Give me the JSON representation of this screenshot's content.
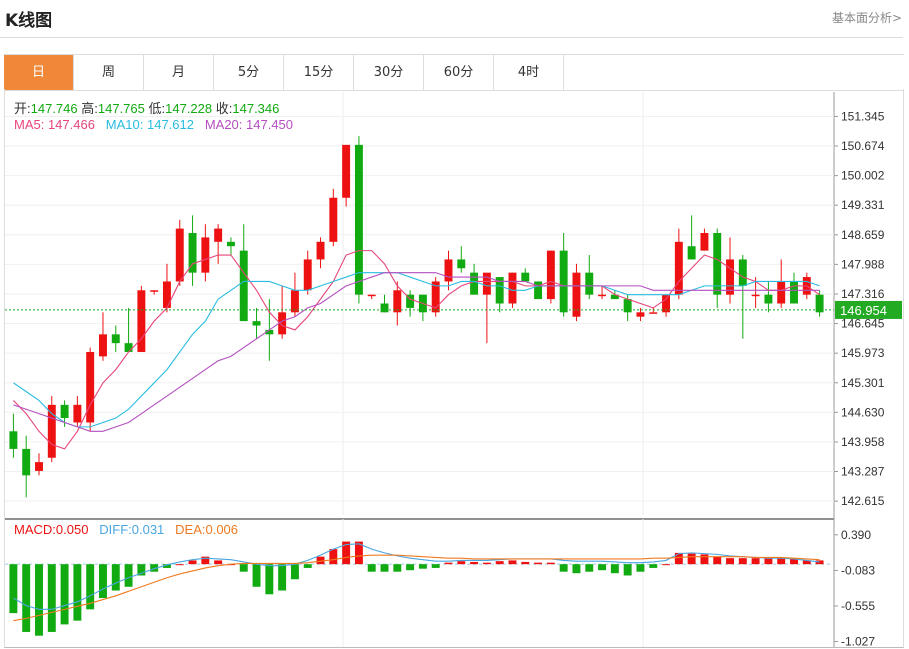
{
  "header": {
    "title": "K线图",
    "analysis_link": "基本面分析>"
  },
  "tabs": [
    {
      "label": "日",
      "active": true
    },
    {
      "label": "周",
      "active": false
    },
    {
      "label": "月",
      "active": false
    },
    {
      "label": "5分",
      "active": false
    },
    {
      "label": "15分",
      "active": false
    },
    {
      "label": "30分",
      "active": false
    },
    {
      "label": "60分",
      "active": false
    },
    {
      "label": "4时",
      "active": false
    }
  ],
  "ohlc_info": {
    "open_label": "开:",
    "open": "147.746",
    "high_label": "高:",
    "high": "147.765",
    "low_label": "低:",
    "low": "147.228",
    "close_label": "收:",
    "close": "147.346"
  },
  "ma_info": {
    "ma5": "MA5: 147.466",
    "ma10": "MA10: 147.612",
    "ma20": "MA20: 147.450"
  },
  "macd_info": {
    "macd": "MACD:0.050",
    "diff": "DIFF:0.031",
    "dea": "DEA:0.006"
  },
  "colors": {
    "up": "#ee1111",
    "down": "#11aa11",
    "ma5": "#e8457a",
    "ma10": "#29bce0",
    "ma20": "#b44fc0",
    "diff": "#4aa6e0",
    "dea": "#f07a20",
    "current": "#22aa22"
  },
  "chart_data": [
    {
      "type": "candlestick",
      "title": "",
      "price_axis_ticks": [
        "151.345",
        "150.674",
        "150.002",
        "149.331",
        "148.659",
        "147.988",
        "147.316",
        "146.645",
        "145.973",
        "145.301",
        "144.630",
        "143.958",
        "143.287",
        "142.615"
      ],
      "ylim": [
        142.3,
        151.9
      ],
      "current_price": "146.954",
      "candles": [
        {
          "o": 144.2,
          "h": 144.6,
          "l": 143.6,
          "c": 143.8
        },
        {
          "o": 143.8,
          "h": 144.1,
          "l": 142.7,
          "c": 143.2
        },
        {
          "o": 143.3,
          "h": 143.7,
          "l": 143.2,
          "c": 143.5
        },
        {
          "o": 143.6,
          "h": 145.0,
          "l": 143.5,
          "c": 144.8
        },
        {
          "o": 144.8,
          "h": 144.9,
          "l": 144.3,
          "c": 144.5
        },
        {
          "o": 144.4,
          "h": 145.0,
          "l": 144.3,
          "c": 144.8
        },
        {
          "o": 144.4,
          "h": 146.1,
          "l": 144.2,
          "c": 146.0
        },
        {
          "o": 145.9,
          "h": 146.9,
          "l": 145.8,
          "c": 146.4
        },
        {
          "o": 146.4,
          "h": 146.6,
          "l": 146.0,
          "c": 146.2
        },
        {
          "o": 146.2,
          "h": 147.0,
          "l": 146.0,
          "c": 146.0
        },
        {
          "o": 146.0,
          "h": 147.5,
          "l": 146.0,
          "c": 147.4
        },
        {
          "o": 147.4,
          "h": 147.4,
          "l": 147.3,
          "c": 147.4
        },
        {
          "o": 147.0,
          "h": 148.0,
          "l": 146.9,
          "c": 147.6
        },
        {
          "o": 147.6,
          "h": 149.0,
          "l": 147.5,
          "c": 148.8
        },
        {
          "o": 148.7,
          "h": 149.1,
          "l": 147.5,
          "c": 147.8
        },
        {
          "o": 147.8,
          "h": 148.9,
          "l": 147.6,
          "c": 148.6
        },
        {
          "o": 148.5,
          "h": 148.9,
          "l": 148.0,
          "c": 148.8
        },
        {
          "o": 148.5,
          "h": 148.6,
          "l": 148.2,
          "c": 148.4
        },
        {
          "o": 148.3,
          "h": 148.9,
          "l": 146.8,
          "c": 146.7
        },
        {
          "o": 146.7,
          "h": 147.0,
          "l": 146.3,
          "c": 146.6
        },
        {
          "o": 146.5,
          "h": 147.2,
          "l": 145.8,
          "c": 146.4
        },
        {
          "o": 146.4,
          "h": 147.5,
          "l": 146.3,
          "c": 146.9
        },
        {
          "o": 146.9,
          "h": 147.8,
          "l": 146.8,
          "c": 147.4
        },
        {
          "o": 147.4,
          "h": 148.3,
          "l": 147.3,
          "c": 148.1
        },
        {
          "o": 148.1,
          "h": 148.6,
          "l": 147.9,
          "c": 148.5
        },
        {
          "o": 148.5,
          "h": 149.7,
          "l": 148.4,
          "c": 149.5
        },
        {
          "o": 149.5,
          "h": 150.7,
          "l": 149.3,
          "c": 150.7
        },
        {
          "o": 150.7,
          "h": 150.9,
          "l": 147.1,
          "c": 147.3
        },
        {
          "o": 147.3,
          "h": 147.3,
          "l": 147.2,
          "c": 147.3
        },
        {
          "o": 147.1,
          "h": 147.3,
          "l": 146.9,
          "c": 146.9
        },
        {
          "o": 146.9,
          "h": 147.6,
          "l": 146.6,
          "c": 147.4
        },
        {
          "o": 147.3,
          "h": 147.4,
          "l": 146.8,
          "c": 147.0
        },
        {
          "o": 147.3,
          "h": 147.3,
          "l": 146.7,
          "c": 146.9
        },
        {
          "o": 146.9,
          "h": 147.7,
          "l": 146.8,
          "c": 147.6
        },
        {
          "o": 147.6,
          "h": 148.3,
          "l": 147.4,
          "c": 148.1
        },
        {
          "o": 148.1,
          "h": 148.4,
          "l": 147.8,
          "c": 147.9
        },
        {
          "o": 147.8,
          "h": 148.0,
          "l": 147.3,
          "c": 147.3
        },
        {
          "o": 147.3,
          "h": 147.7,
          "l": 146.2,
          "c": 147.8
        },
        {
          "o": 147.7,
          "h": 147.7,
          "l": 146.9,
          "c": 147.1
        },
        {
          "o": 147.1,
          "h": 147.8,
          "l": 147.0,
          "c": 147.8
        },
        {
          "o": 147.8,
          "h": 147.9,
          "l": 147.6,
          "c": 147.6
        },
        {
          "o": 147.6,
          "h": 147.6,
          "l": 147.2,
          "c": 147.2
        },
        {
          "o": 147.2,
          "h": 148.3,
          "l": 147.1,
          "c": 148.3
        },
        {
          "o": 148.3,
          "h": 148.7,
          "l": 146.8,
          "c": 146.9
        },
        {
          "o": 146.8,
          "h": 148.0,
          "l": 146.7,
          "c": 147.8
        },
        {
          "o": 147.8,
          "h": 148.2,
          "l": 147.2,
          "c": 147.3
        },
        {
          "o": 147.3,
          "h": 147.5,
          "l": 147.2,
          "c": 147.3
        },
        {
          "o": 147.3,
          "h": 147.4,
          "l": 147.2,
          "c": 147.2
        },
        {
          "o": 147.2,
          "h": 147.3,
          "l": 146.7,
          "c": 146.9
        },
        {
          "o": 146.8,
          "h": 147.0,
          "l": 146.7,
          "c": 146.9
        },
        {
          "o": 146.9,
          "h": 147.0,
          "l": 146.9,
          "c": 146.9
        },
        {
          "o": 146.9,
          "h": 147.3,
          "l": 146.8,
          "c": 147.3
        },
        {
          "o": 147.3,
          "h": 148.8,
          "l": 147.2,
          "c": 148.5
        },
        {
          "o": 148.4,
          "h": 149.1,
          "l": 148.1,
          "c": 148.1
        },
        {
          "o": 148.3,
          "h": 148.8,
          "l": 148.3,
          "c": 148.7
        },
        {
          "o": 148.7,
          "h": 148.8,
          "l": 147.0,
          "c": 147.3
        },
        {
          "o": 147.3,
          "h": 148.6,
          "l": 147.1,
          "c": 148.1
        },
        {
          "o": 148.1,
          "h": 148.2,
          "l": 146.3,
          "c": 147.5
        },
        {
          "o": 147.3,
          "h": 147.7,
          "l": 147.0,
          "c": 147.3
        },
        {
          "o": 147.3,
          "h": 147.6,
          "l": 146.9,
          "c": 147.1
        },
        {
          "o": 147.1,
          "h": 148.1,
          "l": 147.0,
          "c": 147.6
        },
        {
          "o": 147.6,
          "h": 147.8,
          "l": 147.1,
          "c": 147.1
        },
        {
          "o": 147.3,
          "h": 147.8,
          "l": 147.2,
          "c": 147.7
        },
        {
          "o": 147.3,
          "h": 147.4,
          "l": 146.8,
          "c": 146.9
        }
      ],
      "ma5": [
        144.9,
        144.6,
        144.2,
        143.9,
        143.8,
        144.2,
        144.8,
        145.3,
        145.6,
        146.0,
        146.3,
        146.7,
        147.0,
        147.6,
        148.0,
        148.1,
        148.2,
        148.2,
        147.8,
        147.4,
        146.9,
        146.6,
        146.5,
        146.8,
        147.2,
        147.6,
        148.2,
        148.3,
        148.3,
        148.0,
        147.5,
        147.2,
        147.1,
        147.0,
        147.3,
        147.5,
        147.6,
        147.6,
        147.6,
        147.6,
        147.5,
        147.5,
        147.6,
        147.5,
        147.5,
        147.5,
        147.5,
        147.3,
        147.2,
        147.1,
        147.0,
        147.2,
        147.6,
        147.9,
        148.2,
        148.1,
        147.9,
        147.7,
        147.6,
        147.4,
        147.4,
        147.5,
        147.5,
        147.3
      ],
      "ma10": [
        145.3,
        145.1,
        144.9,
        144.6,
        144.4,
        144.3,
        144.3,
        144.4,
        144.5,
        144.7,
        145.0,
        145.3,
        145.6,
        146.0,
        146.4,
        146.7,
        147.2,
        147.4,
        147.6,
        147.6,
        147.6,
        147.5,
        147.4,
        147.4,
        147.5,
        147.6,
        147.7,
        147.8,
        147.8,
        147.8,
        147.8,
        147.7,
        147.6,
        147.5,
        147.5,
        147.6,
        147.6,
        147.5,
        147.5,
        147.4,
        147.4,
        147.5,
        147.5,
        147.5,
        147.5,
        147.5,
        147.5,
        147.4,
        147.3,
        147.3,
        147.3,
        147.3,
        147.3,
        147.4,
        147.5,
        147.5,
        147.5,
        147.5,
        147.6,
        147.6,
        147.6,
        147.6,
        147.6,
        147.5
      ],
      "ma20": [
        144.8,
        144.7,
        144.6,
        144.5,
        144.4,
        144.3,
        144.2,
        144.2,
        144.3,
        144.4,
        144.6,
        144.8,
        145.0,
        145.2,
        145.4,
        145.6,
        145.8,
        145.9,
        146.1,
        146.3,
        146.5,
        146.7,
        146.8,
        147.0,
        147.1,
        147.3,
        147.5,
        147.6,
        147.7,
        147.8,
        147.8,
        147.8,
        147.8,
        147.8,
        147.7,
        147.7,
        147.7,
        147.7,
        147.6,
        147.6,
        147.6,
        147.5,
        147.5,
        147.5,
        147.5,
        147.5,
        147.5,
        147.5,
        147.5,
        147.5,
        147.4,
        147.4,
        147.4,
        147.4,
        147.4,
        147.4,
        147.4,
        147.4,
        147.4,
        147.4,
        147.4,
        147.4,
        147.4,
        147.4
      ]
    },
    {
      "type": "macd",
      "title": "",
      "axis_ticks": [
        "0.390",
        "-0.083",
        "-0.555",
        "-1.027"
      ],
      "ylim": [
        -1.1,
        0.6
      ],
      "macd": [
        -0.65,
        -0.9,
        -0.95,
        -0.9,
        -0.8,
        -0.75,
        -0.6,
        -0.45,
        -0.35,
        -0.3,
        -0.15,
        -0.1,
        -0.05,
        0.0,
        0.05,
        0.1,
        0.05,
        0.0,
        -0.1,
        -0.3,
        -0.4,
        -0.35,
        -0.2,
        -0.05,
        0.1,
        0.2,
        0.3,
        0.3,
        -0.1,
        -0.1,
        -0.1,
        -0.08,
        -0.06,
        -0.05,
        0.02,
        0.04,
        0.03,
        0.02,
        0.04,
        0.05,
        0.03,
        0.02,
        0.02,
        -0.1,
        -0.12,
        -0.1,
        -0.08,
        -0.12,
        -0.15,
        -0.1,
        -0.05,
        0.0,
        0.15,
        0.14,
        0.13,
        0.1,
        0.08,
        0.08,
        0.08,
        0.08,
        0.08,
        0.07,
        0.05,
        0.05
      ],
      "diff": [
        -0.45,
        -0.55,
        -0.6,
        -0.6,
        -0.55,
        -0.5,
        -0.42,
        -0.33,
        -0.25,
        -0.18,
        -0.12,
        -0.06,
        -0.01,
        0.03,
        0.06,
        0.08,
        0.07,
        0.06,
        0.03,
        0.0,
        -0.02,
        -0.02,
        0.0,
        0.05,
        0.12,
        0.2,
        0.26,
        0.27,
        0.2,
        0.15,
        0.11,
        0.08,
        0.06,
        0.04,
        0.04,
        0.05,
        0.05,
        0.05,
        0.06,
        0.07,
        0.07,
        0.07,
        0.07,
        0.05,
        0.04,
        0.04,
        0.04,
        0.03,
        0.02,
        0.02,
        0.03,
        0.05,
        0.14,
        0.15,
        0.14,
        0.13,
        0.11,
        0.1,
        0.09,
        0.08,
        0.08,
        0.07,
        0.05,
        0.03
      ],
      "dea": [
        -0.75,
        -0.72,
        -0.68,
        -0.64,
        -0.6,
        -0.56,
        -0.52,
        -0.47,
        -0.42,
        -0.36,
        -0.3,
        -0.24,
        -0.18,
        -0.13,
        -0.09,
        -0.05,
        -0.02,
        0.0,
        0.01,
        0.01,
        0.01,
        0.01,
        0.01,
        0.02,
        0.04,
        0.06,
        0.09,
        0.11,
        0.12,
        0.12,
        0.12,
        0.11,
        0.1,
        0.09,
        0.08,
        0.08,
        0.07,
        0.07,
        0.07,
        0.07,
        0.07,
        0.07,
        0.07,
        0.07,
        0.07,
        0.07,
        0.07,
        0.07,
        0.07,
        0.07,
        0.08,
        0.08,
        0.09,
        0.1,
        0.1,
        0.1,
        0.1,
        0.1,
        0.09,
        0.09,
        0.09,
        0.08,
        0.07,
        0.06
      ]
    }
  ]
}
